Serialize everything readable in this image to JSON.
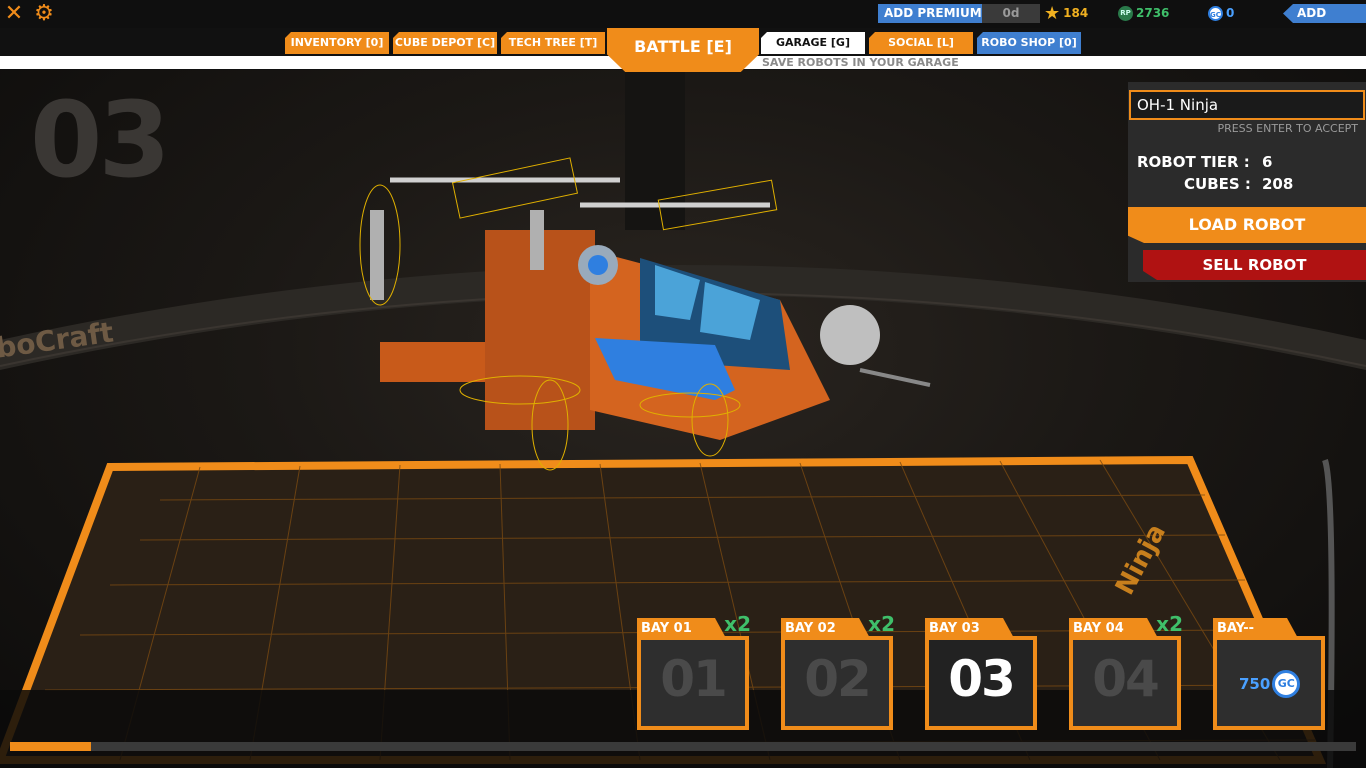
{
  "topbar": {
    "close_icon": "close-icon",
    "settings_icon": "gear-icon",
    "add_premium": "ADD PREMIUM",
    "premium_days": "0d",
    "tech_points": "184",
    "robot_points": "2736",
    "galaxy_cash": "0",
    "add_funds": "ADD FUNDS",
    "colors": {
      "accent": "#f08c1a",
      "blue": "#3f7fd0",
      "green": "#3fbf6a"
    }
  },
  "nav": {
    "tabs": [
      {
        "label": "INVENTORY [0]"
      },
      {
        "label": "CUBE DEPOT [C]"
      },
      {
        "label": "TECH TREE [T]"
      },
      {
        "label": "BATTLE [E]"
      },
      {
        "label": "GARAGE [G]"
      },
      {
        "label": "SOCIAL [L]"
      },
      {
        "label": "ROBO SHOP [0]"
      }
    ],
    "subtitle": "SAVE ROBOTS IN YOUR GARAGE"
  },
  "scene": {
    "bay_number": "03",
    "brand_text": "boCraft",
    "floor_name": "Ninja"
  },
  "panel": {
    "robot_name": "OH-1 Ninja",
    "enter_hint": "PRESS ENTER TO ACCEPT",
    "tier_label": "ROBOT TIER :",
    "tier_value": "6",
    "cubes_label": "CUBES :",
    "cubes_value": "208",
    "load_button": "LOAD ROBOT",
    "sell_button": "SELL ROBOT"
  },
  "bays": [
    {
      "label": "BAY",
      "id": "01",
      "number": "01",
      "multiplier": "x2",
      "selected": false
    },
    {
      "label": "BAY",
      "id": "02",
      "number": "02",
      "multiplier": "x2",
      "selected": false
    },
    {
      "label": "BAY",
      "id": "03",
      "number": "03",
      "multiplier": "",
      "selected": true
    },
    {
      "label": "BAY",
      "id": "04",
      "number": "04",
      "multiplier": "x2",
      "selected": false
    },
    {
      "label": "BAY",
      "id": "--",
      "price": "750",
      "currency": "GC"
    }
  ],
  "progress": {
    "fraction": 0.06
  }
}
